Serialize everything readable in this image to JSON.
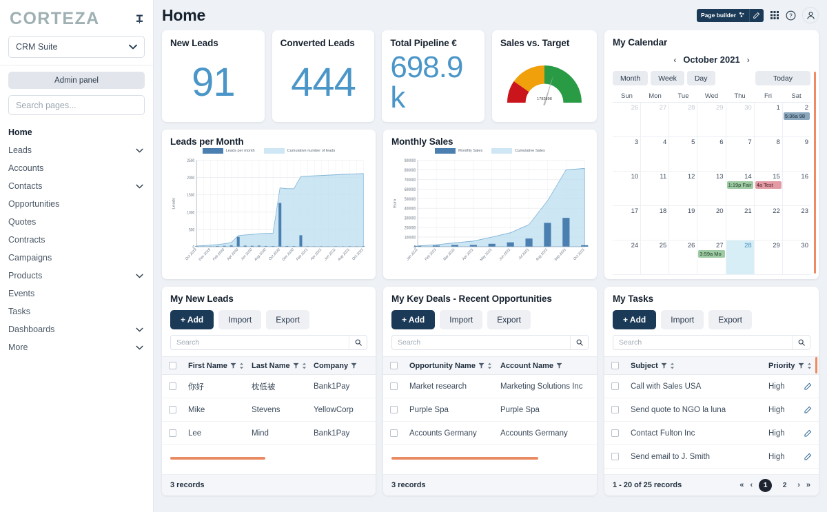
{
  "sidebar": {
    "brand": "CORTEZA",
    "pin_icon": "pin-icon",
    "suite_selected": "CRM Suite",
    "admin_panel_label": "Admin panel",
    "search_placeholder": "Search pages...",
    "items": [
      {
        "label": "Home",
        "expandable": false,
        "active": true
      },
      {
        "label": "Leads",
        "expandable": true,
        "active": false
      },
      {
        "label": "Accounts",
        "expandable": false,
        "active": false
      },
      {
        "label": "Contacts",
        "expandable": true,
        "active": false
      },
      {
        "label": "Opportunities",
        "expandable": false,
        "active": false
      },
      {
        "label": "Quotes",
        "expandable": false,
        "active": false
      },
      {
        "label": "Contracts",
        "expandable": false,
        "active": false
      },
      {
        "label": "Campaigns",
        "expandable": false,
        "active": false
      },
      {
        "label": "Products",
        "expandable": true,
        "active": false
      },
      {
        "label": "Events",
        "expandable": false,
        "active": false
      },
      {
        "label": "Tasks",
        "expandable": false,
        "active": false
      },
      {
        "label": "Dashboards",
        "expandable": true,
        "active": false
      },
      {
        "label": "More",
        "expandable": true,
        "active": false
      }
    ]
  },
  "topbar": {
    "title": "Home",
    "page_builder_label": "Page builder",
    "icons": [
      "settings-icon",
      "edit-icon",
      "grid-apps-icon",
      "help-icon",
      "user-avatar-icon"
    ]
  },
  "kpis": [
    {
      "title": "New Leads",
      "value": "91"
    },
    {
      "title": "Converted Leads",
      "value": "444"
    },
    {
      "title": "Total Pipeline €",
      "value": "698.9 k"
    },
    {
      "title": "Sales vs. Target",
      "gauge_value": "1782898"
    }
  ],
  "charts": {
    "leads_card_title": "Leads per Month",
    "sales_card_title": "Monthly Sales"
  },
  "chart_data": [
    {
      "type": "bar",
      "title": "Leads per Month",
      "xlabel": "",
      "ylabel": "Leads",
      "ylim": [
        0,
        2500
      ],
      "yticks": [
        0,
        500,
        1000,
        1500,
        2000,
        2500
      ],
      "grid": true,
      "legend_position": "top",
      "categories": [
        "Oct 2019",
        "Nov 2019",
        "Dec 2019",
        "Jan 2020",
        "Feb 2020",
        "Mar 2020",
        "Apr 2020",
        "May 2020",
        "Jun 2020",
        "Jul 2020",
        "Aug 2020",
        "Sep 2020",
        "Oct 2020",
        "Nov 2020",
        "Dec 2020",
        "Jan 2021",
        "Feb 2021",
        "Mar 2021",
        "Apr 2021",
        "May 2021",
        "Jun 2021",
        "Jul 2021",
        "Aug 2021",
        "Sep 2021",
        "Oct 2021"
      ],
      "tick_labels": [
        "Oct 2019",
        "Dec 2019",
        "Feb 2020",
        "Apr 2020",
        "Jun 2020",
        "Aug 2020",
        "Oct 2020",
        "Dec 2020",
        "Feb 2021",
        "Apr 2021",
        "Jun 2021",
        "Aug 2021",
        "Oct 2021"
      ],
      "series": [
        {
          "name": "Leads per month",
          "kind": "bar",
          "color": "#4a7fb0",
          "values": [
            15,
            10,
            12,
            20,
            25,
            35,
            285,
            30,
            25,
            30,
            20,
            18,
            1265,
            20,
            15,
            330,
            12,
            10,
            12,
            10,
            12,
            10,
            12,
            10,
            15
          ]
        },
        {
          "name": "Cumulative number of leads",
          "kind": "area",
          "color": "#bcddf0",
          "values": [
            20,
            30,
            45,
            60,
            85,
            120,
            320,
            340,
            355,
            375,
            385,
            390,
            1700,
            1680,
            1675,
            2030,
            2040,
            2050,
            2060,
            2070,
            2080,
            2090,
            2100,
            2105,
            2115
          ]
        }
      ]
    },
    {
      "type": "bar",
      "title": "Monthly Sales",
      "xlabel": "",
      "ylabel": "Euro",
      "ylim": [
        0,
        900000
      ],
      "yticks": [
        0,
        100000,
        200000,
        300000,
        400000,
        500000,
        600000,
        700000,
        800000,
        900000
      ],
      "grid": true,
      "legend_position": "top",
      "categories": [
        "Jan 2021",
        "Feb 2021",
        "Mar 2021",
        "Apr 2021",
        "May 2021",
        "Jun 2021",
        "Jul 2021",
        "Aug 2021",
        "Sep 2021",
        "Oct 2021"
      ],
      "tick_labels": [
        "Jan 2021",
        "Feb 2021",
        "Mar 2021",
        "Apr 2021",
        "May 2021",
        "Jun 2021",
        "Jul 2021",
        "Aug 2021",
        "Sep 2021",
        "Oct 2021"
      ],
      "series": [
        {
          "name": "Monthly Sales",
          "kind": "bar",
          "color": "#4a7fb0",
          "values": [
            8000,
            12000,
            18000,
            18000,
            30000,
            45000,
            85000,
            248000,
            300000,
            15000
          ]
        },
        {
          "name": "Cumulative Sales",
          "kind": "area",
          "color": "#bcddf0",
          "values": [
            8000,
            20000,
            40000,
            58000,
            100000,
            145000,
            230000,
            478000,
            800000,
            815000
          ]
        }
      ]
    }
  ],
  "calendar": {
    "title": "My Calendar",
    "month_label": "October 2021",
    "prev_icon": "chevron-left-icon",
    "next_icon": "chevron-right-icon",
    "view_buttons": [
      "Month",
      "Week",
      "Day"
    ],
    "today_label": "Today",
    "weekday_headers": [
      "Sun",
      "Mon",
      "Tue",
      "Wed",
      "Thu",
      "Fri",
      "Sat"
    ],
    "weeks": [
      [
        {
          "day": "26",
          "muted": true
        },
        {
          "day": "27",
          "muted": true
        },
        {
          "day": "28",
          "muted": true
        },
        {
          "day": "29",
          "muted": true
        },
        {
          "day": "30",
          "muted": true
        },
        {
          "day": "1",
          "muted": false
        },
        {
          "day": "2",
          "muted": false,
          "event": {
            "text": "5:36a 98",
            "style": "ev-blue"
          }
        }
      ],
      [
        {
          "day": "3"
        },
        {
          "day": "4"
        },
        {
          "day": "5"
        },
        {
          "day": "6"
        },
        {
          "day": "7"
        },
        {
          "day": "8"
        },
        {
          "day": "9"
        }
      ],
      [
        {
          "day": "10"
        },
        {
          "day": "11"
        },
        {
          "day": "12"
        },
        {
          "day": "13"
        },
        {
          "day": "14",
          "event": {
            "text": "1:19p Fair",
            "style": "ev-green"
          }
        },
        {
          "day": "15",
          "event": {
            "text": "4a Test",
            "style": "ev-red"
          }
        },
        {
          "day": "16"
        }
      ],
      [
        {
          "day": "17"
        },
        {
          "day": "18"
        },
        {
          "day": "19"
        },
        {
          "day": "20"
        },
        {
          "day": "21"
        },
        {
          "day": "22"
        },
        {
          "day": "23"
        }
      ],
      [
        {
          "day": "24"
        },
        {
          "day": "25"
        },
        {
          "day": "26"
        },
        {
          "day": "27",
          "event": {
            "text": "3:59a Mo",
            "style": "ev-green"
          }
        },
        {
          "day": "28",
          "today": true
        },
        {
          "day": "29"
        },
        {
          "day": "30"
        }
      ]
    ]
  },
  "leads_panel": {
    "title": "My New Leads",
    "add_label": "+ Add",
    "import_label": "Import",
    "export_label": "Export",
    "search_placeholder": "Search",
    "columns": [
      "First Name",
      "Last Name",
      "Company"
    ],
    "rows": [
      {
        "first": "你好",
        "last": "枕低被",
        "company": "Bank1Pay"
      },
      {
        "first": "Mike",
        "last": "Stevens",
        "company": "YellowCorp"
      },
      {
        "first": "Lee",
        "last": "Mind",
        "company": "Bank1Pay"
      }
    ],
    "footer": "3 records"
  },
  "deals_panel": {
    "title": "My Key Deals - Recent Opportunities",
    "add_label": "+ Add",
    "import_label": "Import",
    "export_label": "Export",
    "search_placeholder": "Search",
    "columns": [
      "Opportunity Name",
      "Account Name"
    ],
    "rows": [
      {
        "opportunity": "Market research",
        "account": "Marketing Solutions Inc"
      },
      {
        "opportunity": "Purple Spa",
        "account": "Purple Spa"
      },
      {
        "opportunity": "Accounts Germany",
        "account": "Accounts Germany"
      }
    ],
    "footer": "3 records"
  },
  "tasks_panel": {
    "title": "My Tasks",
    "add_label": "+ Add",
    "import_label": "Import",
    "export_label": "Export",
    "search_placeholder": "Search",
    "columns": [
      "Subject",
      "Priority"
    ],
    "rows": [
      {
        "subject": "Call with Sales USA",
        "priority": "High"
      },
      {
        "subject": "Send quote to NGO la luna",
        "priority": "High"
      },
      {
        "subject": "Contact Fulton Inc",
        "priority": "High"
      },
      {
        "subject": "Send email to J. Smith",
        "priority": "High"
      }
    ],
    "footer": "1 - 20 of 25 records",
    "pager": {
      "first": "«",
      "prev": "‹",
      "pages": [
        "1",
        "2"
      ],
      "active_page": "1",
      "next": "›",
      "last": "»"
    }
  },
  "colors": {
    "accent_dark": "#1b3a57",
    "kpi_blue": "#4a96c8",
    "scrollbar_orange": "#e98a62",
    "gauge_red": "#c9151b",
    "gauge_orange": "#efa00b",
    "gauge_green": "#2a9b45",
    "page_bg": "#eef1f5"
  }
}
